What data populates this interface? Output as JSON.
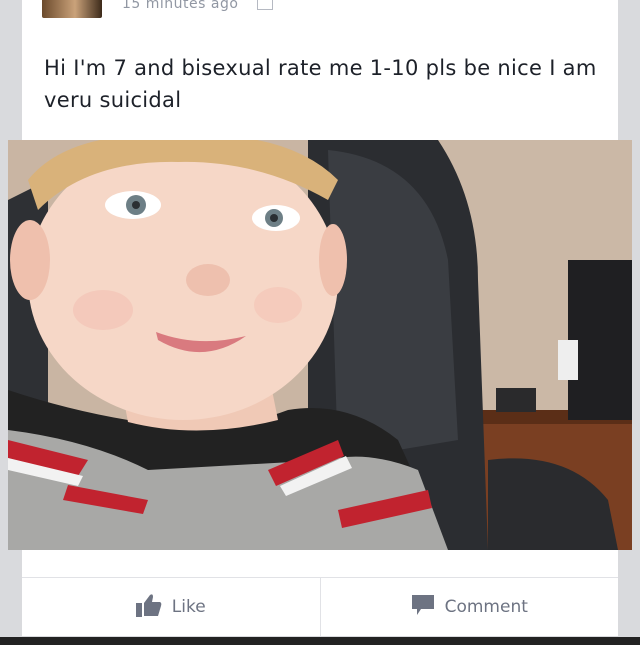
{
  "post": {
    "timestamp": "15 minutes ago",
    "text": "Hi I'm 7 and bisexual rate me 1-10 pls be nice I am veru suicidal"
  },
  "photo": {
    "subject": "child-selfie-photo"
  },
  "actions": {
    "like_label": "Like",
    "comment_label": "Comment"
  },
  "icons": {
    "like": "thumbs-up-icon",
    "comment": "speech-bubble-icon",
    "privacy": "friends-icon"
  },
  "colors": {
    "action_text": "#6d7382",
    "background": "#d9dadd"
  }
}
